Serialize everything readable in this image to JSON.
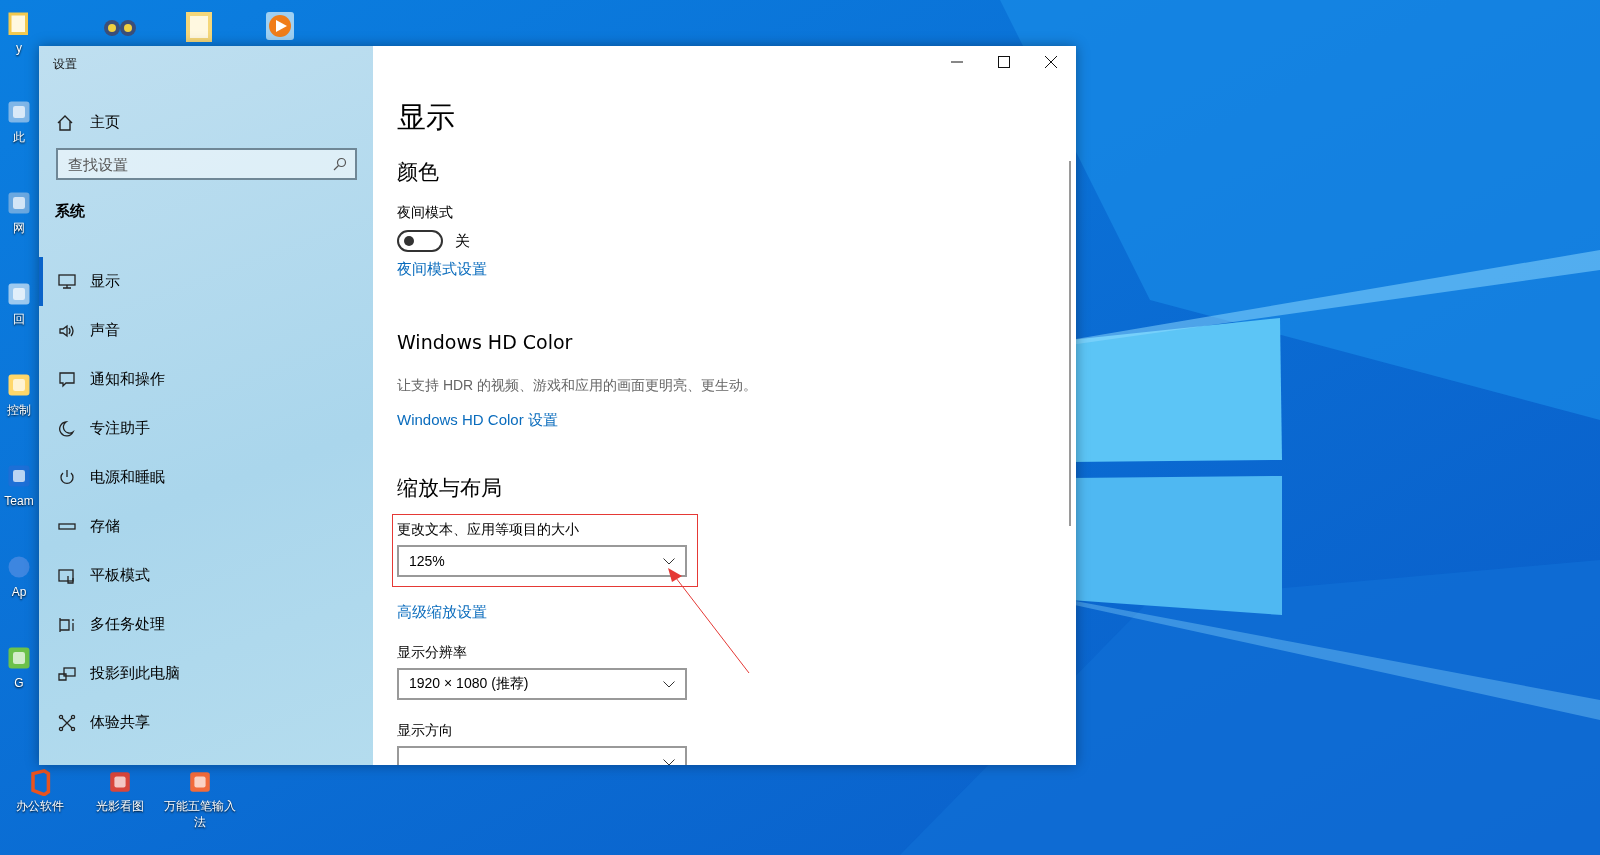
{
  "desktop_icons": [
    {
      "kind": "user-folder",
      "label": "y"
    },
    {
      "kind": "binoculars"
    },
    {
      "kind": "document"
    },
    {
      "kind": "player"
    },
    {
      "kind": "computer",
      "label": "此"
    },
    {
      "kind": "network",
      "label": "网"
    },
    {
      "kind": "recycle",
      "label": "回"
    },
    {
      "kind": "control",
      "label": "控制"
    },
    {
      "kind": "remote",
      "label": "Team"
    },
    {
      "kind": "sphere",
      "label": "Ap"
    },
    {
      "kind": "green-app",
      "label": "G"
    },
    {
      "kind": "office",
      "label": "办公软件"
    },
    {
      "label": "光影看图"
    },
    {
      "kind": "pen",
      "label": "万能五笔输入法"
    }
  ],
  "window": {
    "title": "设置",
    "sidebar": {
      "home": "主页",
      "search": {
        "placeholder": "查找设置"
      },
      "section": "系统",
      "items": [
        {
          "label": "显示",
          "selected": true
        },
        {
          "label": "声音",
          "selected": false
        },
        {
          "label": "通知和操作",
          "selected": false
        },
        {
          "label": "专注助手",
          "selected": false
        },
        {
          "label": "电源和睡眠",
          "selected": false
        },
        {
          "label": "存储",
          "selected": false
        },
        {
          "label": "平板模式",
          "selected": false
        },
        {
          "label": "多任务处理",
          "selected": false
        },
        {
          "label": "投影到此电脑",
          "selected": false
        },
        {
          "label": "体验共享",
          "selected": false
        }
      ]
    },
    "content": {
      "title": "显示",
      "color_section": {
        "heading": "颜色",
        "night_label": "夜间模式",
        "night_toggle": {
          "on": false,
          "state_text": "关"
        },
        "night_link": "夜间模式设置"
      },
      "hdr_section": {
        "heading": "Windows HD Color",
        "description": "让支持 HDR 的视频、游戏和应用的画面更明亮、更生动。",
        "link": "Windows HD Color 设置"
      },
      "scale_section": {
        "heading": "缩放与布局",
        "scale": {
          "label": "更改文本、应用等项目的大小",
          "value": "125%",
          "highlighted": true
        },
        "advanced_link": "高级缩放设置",
        "resolution": {
          "label": "显示分辨率",
          "value": "1920 × 1080 (推荐)"
        },
        "orientation": {
          "label": "显示方向"
        }
      }
    }
  }
}
